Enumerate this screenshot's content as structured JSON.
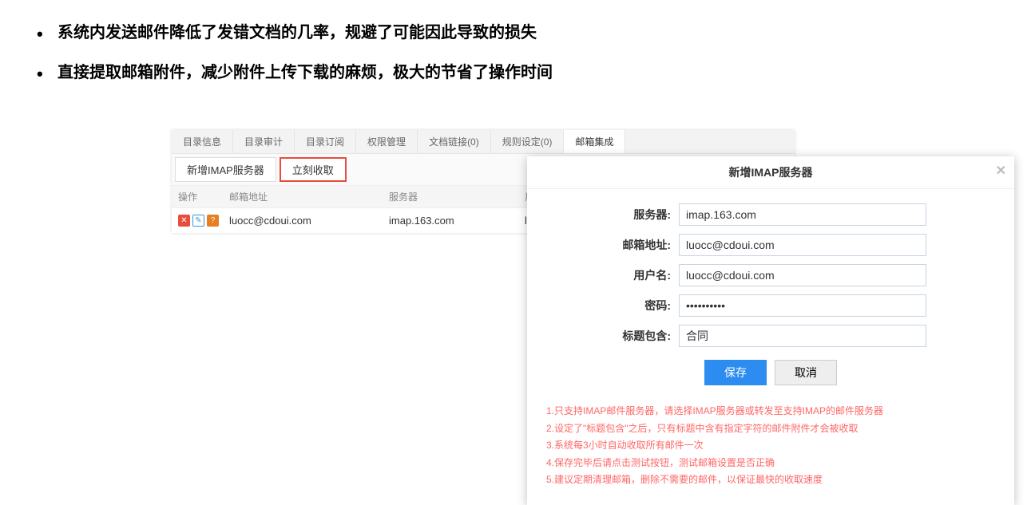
{
  "bullets": {
    "item0": "系统内发送邮件降低了发错文档的几率，规避了可能因此导致的损失",
    "item1": "直接提取邮箱附件，减少附件上传下载的麻烦，极大的节省了操作时间"
  },
  "tabs": {
    "t0": "目录信息",
    "t1": "目录审计",
    "t2": "目录订阅",
    "t3": "权限管理",
    "t4": "文档链接(0)",
    "t5": "规则设定(0)",
    "t6": "邮箱集成"
  },
  "toolbar": {
    "add_server": "新增IMAP服务器",
    "fetch_now": "立刻收取"
  },
  "table": {
    "headers": {
      "ops": "操作",
      "addr": "邮箱地址",
      "srv": "服务器",
      "user": "用户名"
    },
    "rows": [
      {
        "addr": "luocc@cdoui.com",
        "srv": "imap.163.com",
        "user": "luocc@cdoui."
      }
    ]
  },
  "dialog": {
    "title": "新增IMAP服务器",
    "labels": {
      "server": "服务器:",
      "addr": "邮箱地址:",
      "user": "用户名:",
      "password": "密码:",
      "subject": "标题包含:"
    },
    "values": {
      "server": "imap.163.com",
      "addr": "luocc@cdoui.com",
      "user": "luocc@cdoui.com",
      "password": "••••••••••",
      "subject": "合同"
    },
    "actions": {
      "save": "保存",
      "cancel": "取消"
    },
    "notes": {
      "n1": "1.只支持IMAP邮件服务器，请选择IMAP服务器或转发至支持IMAP的邮件服务器",
      "n2": "2.设定了\"标题包含\"之后，只有标题中含有指定字符的邮件附件才会被收取",
      "n3": "3.系统每3小时自动收取所有邮件一次",
      "n4": "4.保存完毕后请点击测试按钮，测试邮箱设置是否正确",
      "n5": "5.建议定期清理邮箱，删除不需要的邮件，以保证最快的收取速度"
    }
  }
}
